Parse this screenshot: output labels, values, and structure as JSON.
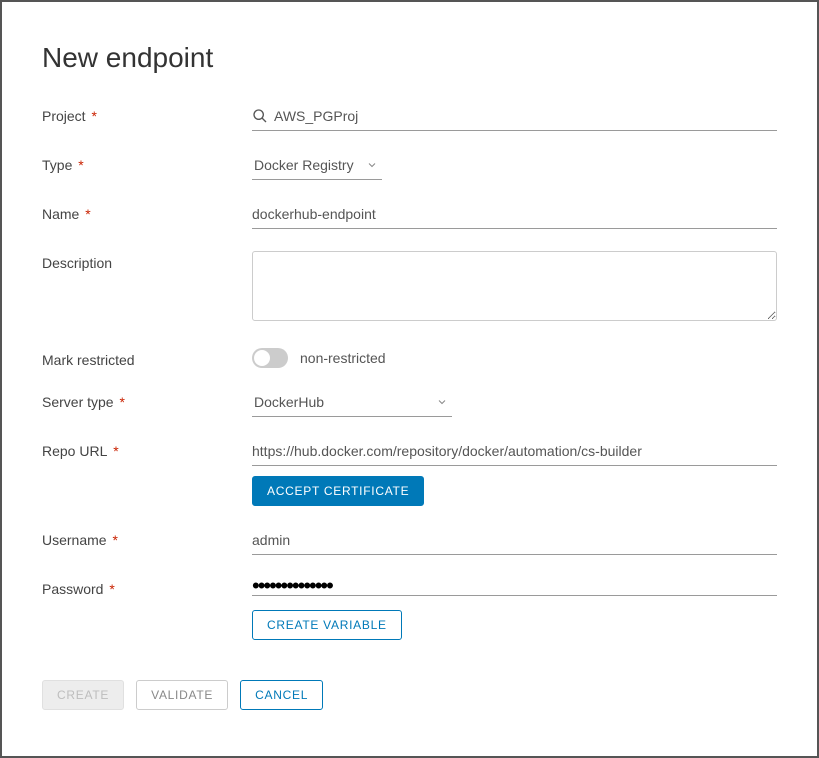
{
  "title": "New endpoint",
  "labels": {
    "project": "Project",
    "type": "Type",
    "name": "Name",
    "description": "Description",
    "mark_restricted": "Mark restricted",
    "server_type": "Server type",
    "repo_url": "Repo URL",
    "username": "Username",
    "password": "Password"
  },
  "values": {
    "project": "AWS_PGProj",
    "type": "Docker Registry",
    "name": "dockerhub-endpoint",
    "description": "",
    "restricted_state": "non-restricted",
    "server_type": "DockerHub",
    "repo_url": "https://hub.docker.com/repository/docker/automation/cs-builder",
    "username": "admin",
    "password_mask": "••••••••••••••"
  },
  "buttons": {
    "accept_cert": "ACCEPT CERTIFICATE",
    "create_variable": "CREATE VARIABLE",
    "create": "CREATE",
    "validate": "VALIDATE",
    "cancel": "CANCEL"
  }
}
